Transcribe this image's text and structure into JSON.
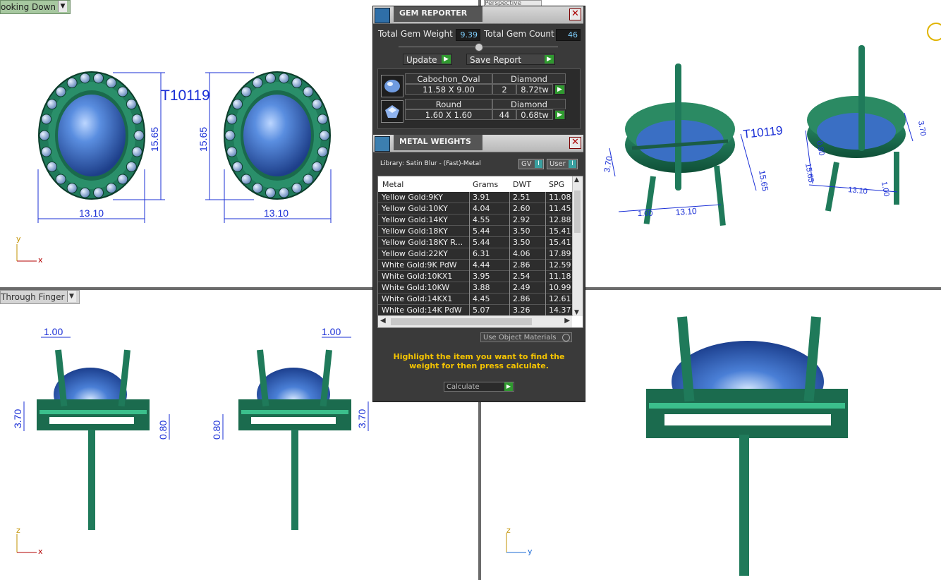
{
  "viewports": {
    "top_left": {
      "label": "ooking Down",
      "annotation": "T10119",
      "dims": {
        "width_left": "13.10",
        "width_right": "13.10",
        "height_left": "15.65",
        "height_right": "15.65"
      },
      "axis_y": "y",
      "axis_x": "x"
    },
    "top_right": {
      "tab": "Perspective",
      "dims": [
        "3.70",
        "15.65",
        "13.10",
        "1.00",
        "0.80",
        "15.65",
        "3.70",
        "1.00",
        "13.10"
      ],
      "annotation": "T10119"
    },
    "bottom_left": {
      "label": "Through Finger",
      "dims": {
        "prong_left": "1.00",
        "prong_right": "1.00",
        "h_left": "3.70",
        "h_right": "3.70",
        "gap_left": "0.80",
        "gap_right": "0.80"
      },
      "axis_z": "z",
      "axis_x": "x"
    },
    "bottom_right": {
      "axis_z": "z",
      "axis_y": "y"
    }
  },
  "gem_reporter": {
    "title": "GEM REPORTER",
    "total_weight_label": "Total Gem Weight",
    "total_weight_value": "9.39",
    "total_count_label": "Total Gem Count",
    "total_count_value": "46",
    "update_label": "Update",
    "save_label": "Save Report",
    "gems": [
      {
        "shape": "Cabochon_Oval",
        "size": "11.58 X 9.00",
        "material": "Diamond",
        "count": "2",
        "weight": "8.72tw"
      },
      {
        "shape": "Round",
        "size": "1.60 X 1.60",
        "material": "Diamond",
        "count": "44",
        "weight": "0.68tw"
      }
    ]
  },
  "metal_weights": {
    "title": "METAL WEIGHTS",
    "library": "Library: Satin Blur - (Fast)-Metal",
    "gv_label": "GV",
    "user_label": "User",
    "columns": [
      "Metal",
      "Grams",
      "DWT",
      "SPG"
    ],
    "rows": [
      [
        "Yellow Gold:9KY",
        "3.91",
        "2.51",
        "11.08"
      ],
      [
        "Yellow Gold:10KY",
        "4.04",
        "2.60",
        "11.45"
      ],
      [
        "Yellow Gold:14KY",
        "4.55",
        "2.92",
        "12.88"
      ],
      [
        "Yellow Gold:18KY",
        "5.44",
        "3.50",
        "15.41"
      ],
      [
        "Yellow Gold:18KY R...",
        "5.44",
        "3.50",
        "15.41"
      ],
      [
        "Yellow Gold:22KY",
        "6.31",
        "4.06",
        "17.89"
      ],
      [
        "White Gold:9K PdW",
        "4.44",
        "2.86",
        "12.59"
      ],
      [
        "White Gold:10KX1",
        "3.95",
        "2.54",
        "11.18"
      ],
      [
        "White Gold:10KW",
        "3.88",
        "2.49",
        "10.99"
      ],
      [
        "White Gold:14KX1",
        "4.45",
        "2.86",
        "12.61"
      ],
      [
        "White Gold:14K PdW",
        "5.07",
        "3.26",
        "14.37"
      ]
    ],
    "use_object_materials": "Use Object Materials",
    "hint": "Highlight the item you want to find the weight for then press calculate.",
    "calculate_label": "Calculate"
  }
}
